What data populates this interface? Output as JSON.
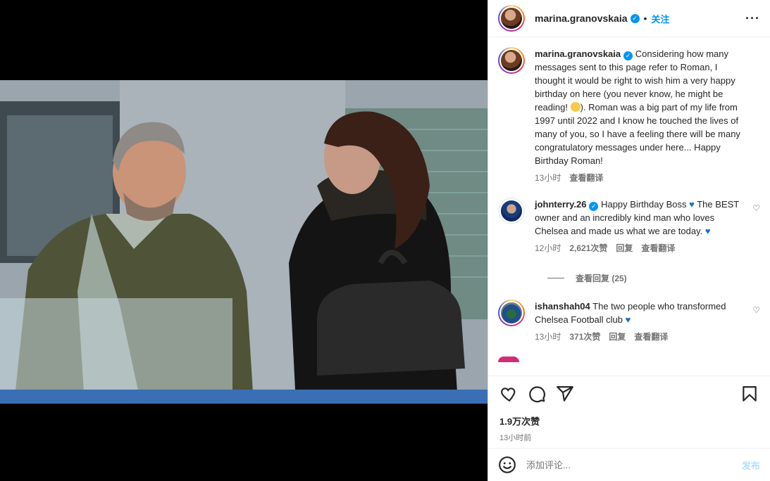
{
  "header": {
    "username": "marina.granovskaia",
    "separator": "•",
    "follow_label": "关注",
    "more_label": "···"
  },
  "caption": {
    "username": "marina.granovskaia",
    "text_before_emoji": "Considering how many messages sent to this page refer to Roman, I thought it would be right to wish him a very happy birthday on here (you never know, he might be reading! ",
    "text_after_emoji": "). Roman was a big part of my life from 1997 until 2022 and I know he touched the lives of many of you, so I have a feeling there will be many congratulatory messages under here... Happy Birthday Roman!",
    "time": "13小时",
    "translate": "查看翻译"
  },
  "comments": [
    {
      "username": "johnterry.26",
      "verified": true,
      "text": "Happy Birthday Boss",
      "text2": "The BEST owner and an incredibly kind man who loves Chelsea and made us what we are today.",
      "time": "12小时",
      "likes": "2,621次赞",
      "reply": "回复",
      "translate": "查看翻译",
      "view_replies": "查看回复 (25)"
    },
    {
      "username": "ishanshah04",
      "verified": false,
      "text": "The two people who transformed Chelsea Football club",
      "time": "13小时",
      "likes": "371次赞",
      "reply": "回复",
      "translate": "查看翻译"
    }
  ],
  "actions": {
    "likes": "1.9万次赞",
    "time": "13小时前"
  },
  "add_comment": {
    "placeholder": "添加评论...",
    "post_label": "发布"
  },
  "icons": [
    "heart-icon",
    "comment-icon",
    "share-icon",
    "bookmark-icon",
    "emoji-icon",
    "more-icon",
    "verified-icon"
  ],
  "colors": {
    "accent": "#0095f6",
    "post_disabled": "#b2dffc",
    "meta_gray": "#737373"
  }
}
